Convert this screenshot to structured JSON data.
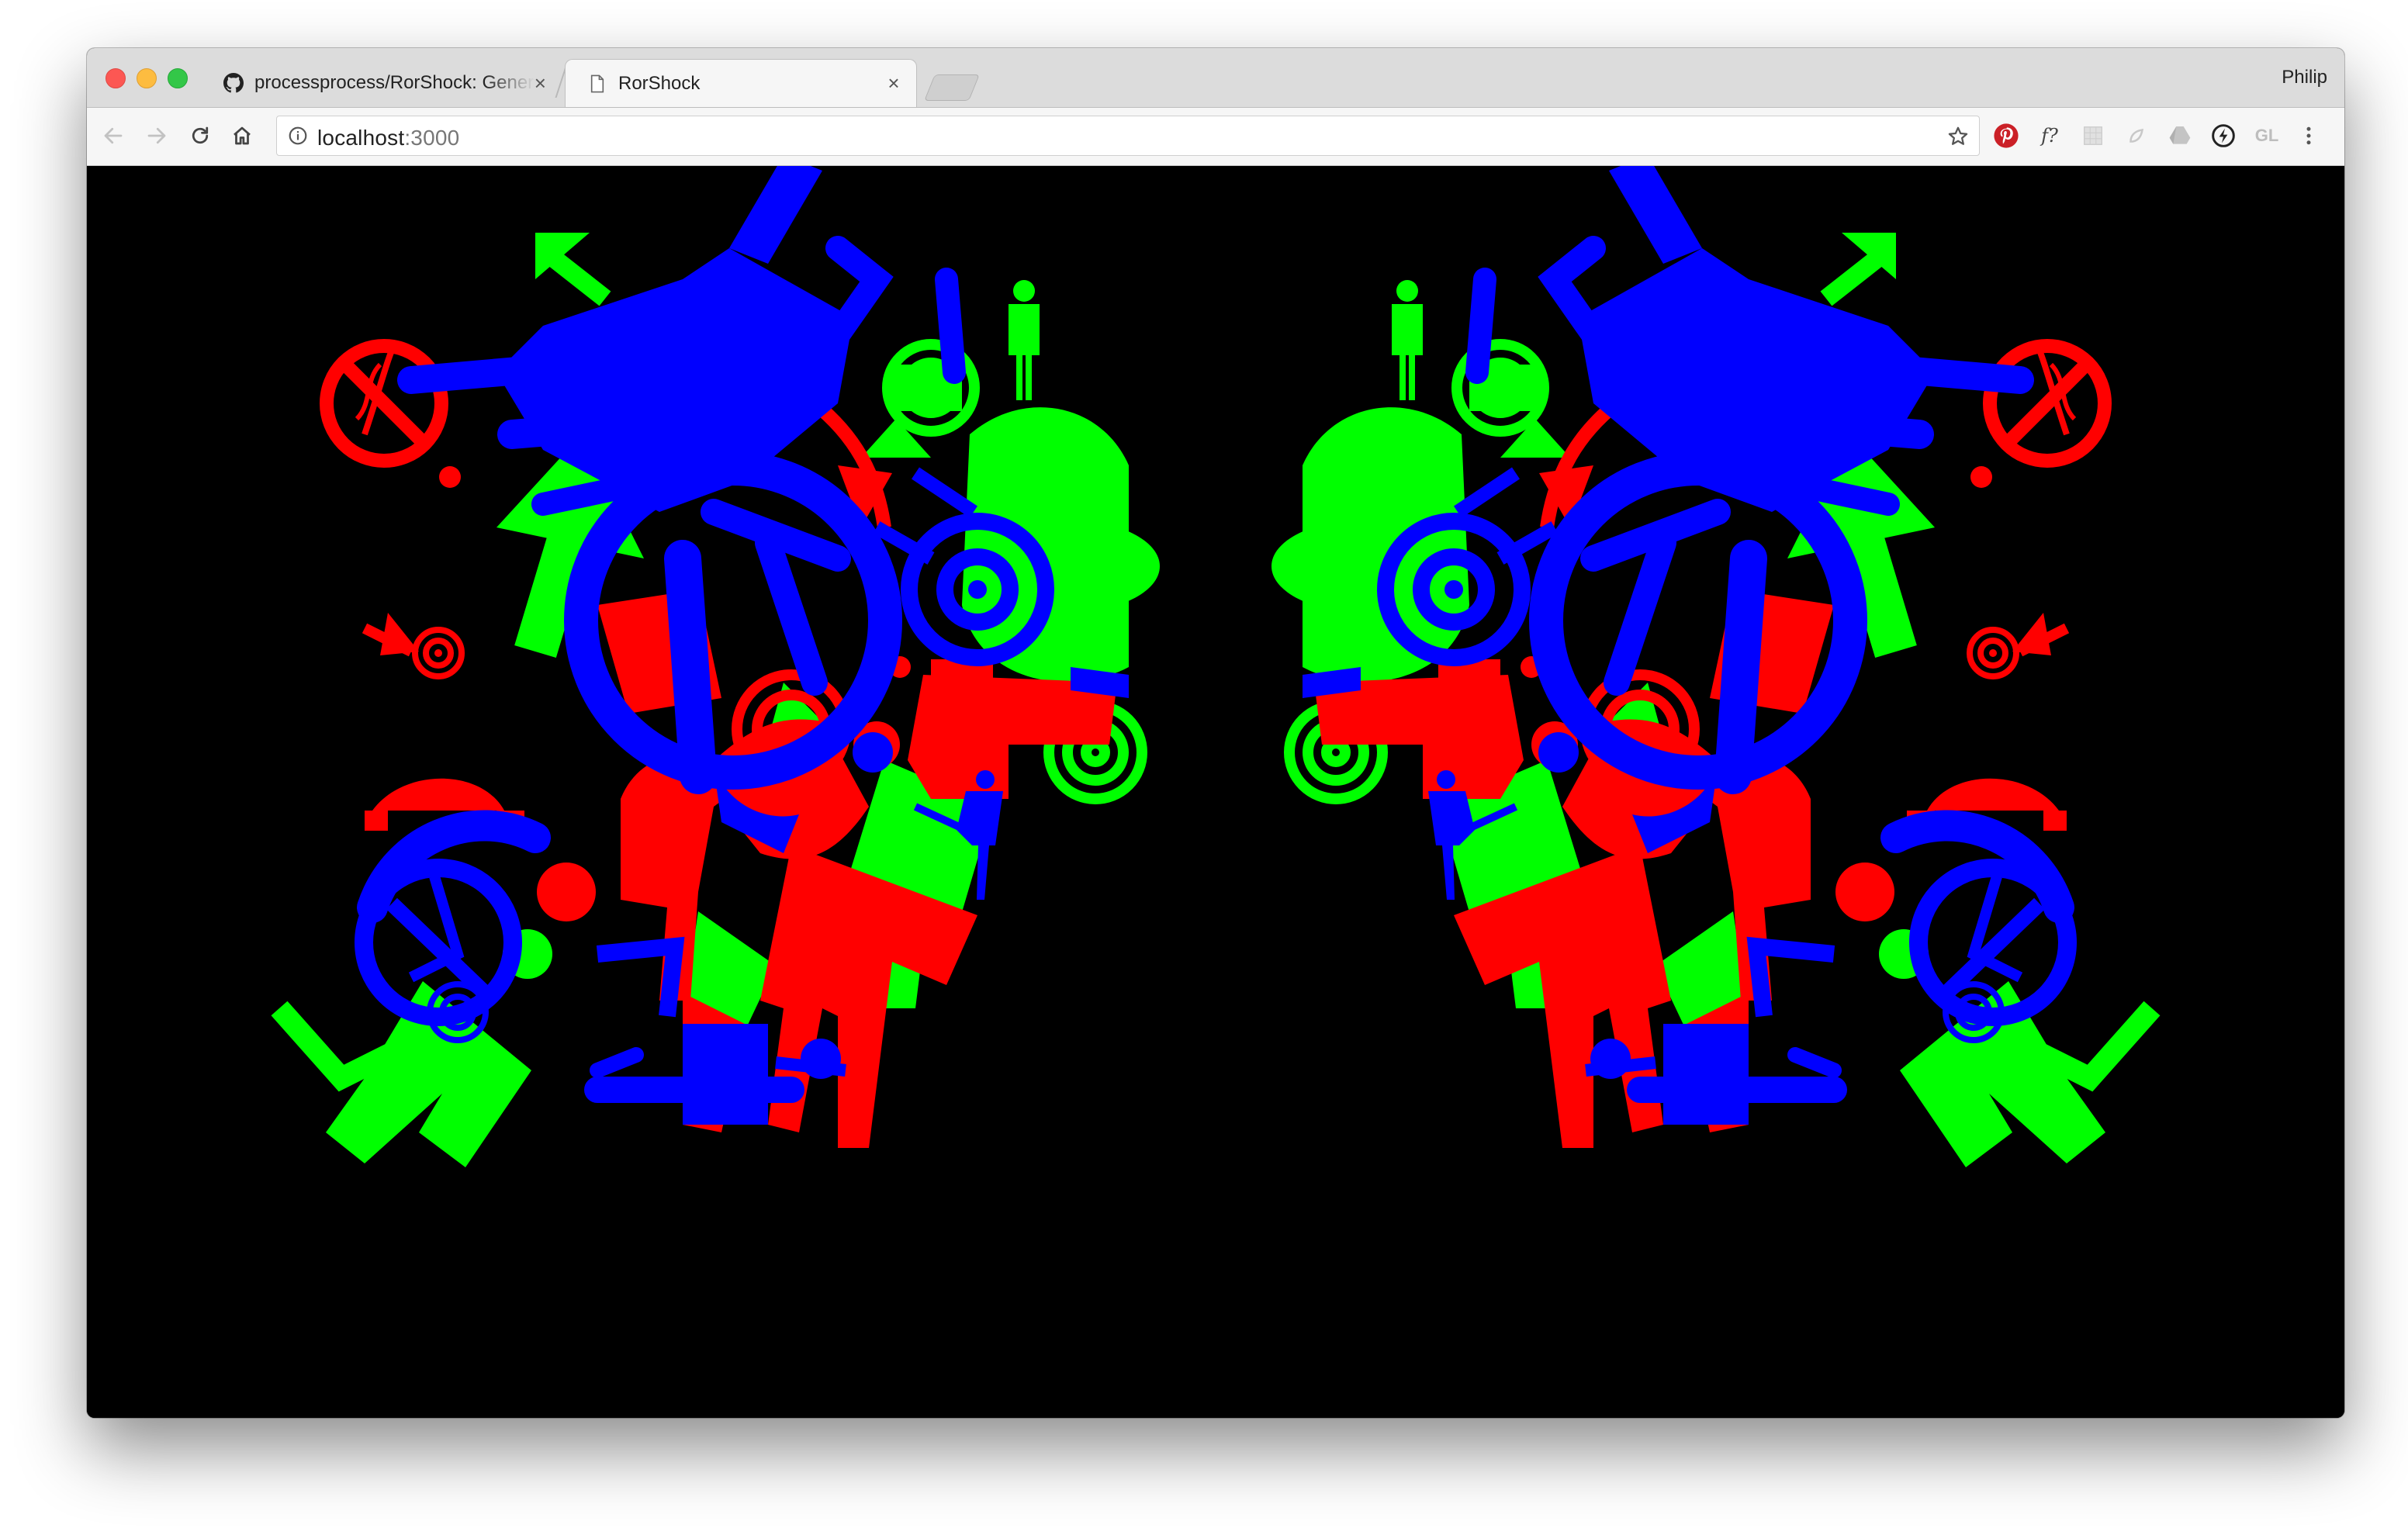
{
  "browser": {
    "tabs": [
      {
        "title": "processprocess/RorShock: Generate inkblot style images",
        "active": false,
        "favicon": "github-icon"
      },
      {
        "title": "RorShock",
        "active": true,
        "favicon": "page-icon"
      }
    ],
    "profile_name": "Philip",
    "address": {
      "host": "localhost",
      "port": ":3000"
    },
    "extensions": [
      "pinterest-icon",
      "whatfont-icon",
      "extension-icon",
      "extension-icon",
      "drive-icon",
      "extension-icon",
      "gl-icon",
      "menu-icon"
    ],
    "extension_text": {
      "whatfont": "f?",
      "gl": "GL"
    }
  },
  "colors": {
    "red": "#ff0000",
    "green": "#00ff00",
    "blue": "#0000ff",
    "background": "#000000"
  },
  "artwork": {
    "pictograms": [
      "wheelchair-icon",
      "person-icon",
      "target-icon",
      "arrow-icon",
      "no-smoking-icon",
      "telephone-icon"
    ]
  }
}
